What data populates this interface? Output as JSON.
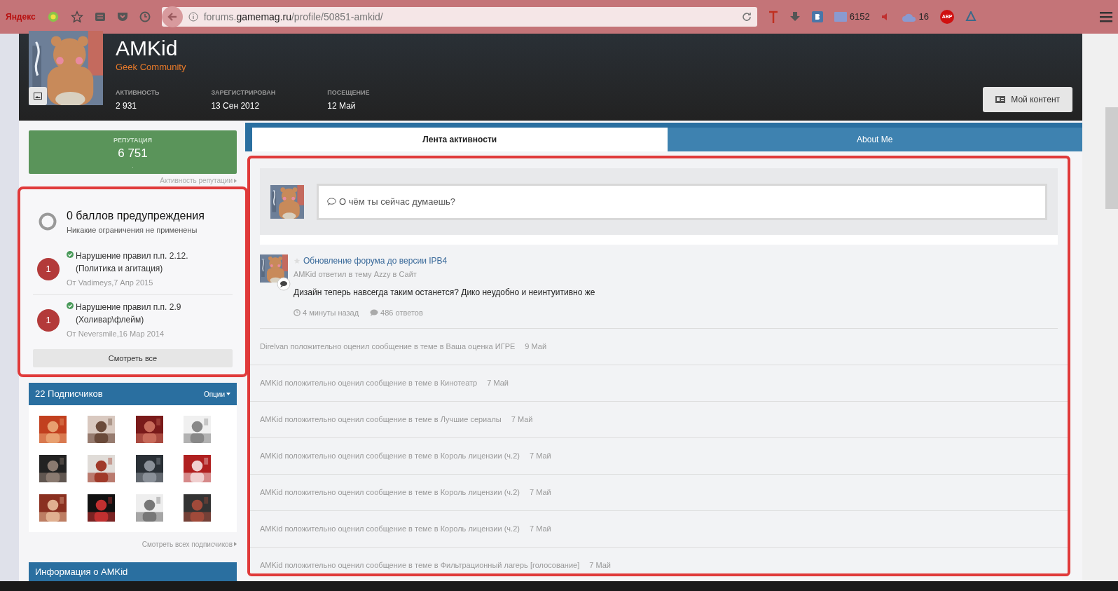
{
  "browser": {
    "brand": "Яндекс",
    "url_prefix": "forums.",
    "url_domain": "gamemag.ru",
    "url_path": "/profile/50851-amkid/",
    "mail_count": "6152",
    "cloud_count": "16",
    "adblock_label": "ABP"
  },
  "profile": {
    "name": "AMKid",
    "group": "Geek Community",
    "stats": [
      {
        "label": "АКТИВНОСТЬ",
        "value": "2 931"
      },
      {
        "label": "ЗАРЕГИСТРИРОВАН",
        "value": "13 Сен 2012"
      },
      {
        "label": "ПОСЕЩЕНИЕ",
        "value": "12 Май"
      }
    ],
    "content_button": "Мой контент"
  },
  "reputation": {
    "label": "РЕПУТАЦИЯ",
    "value": "6 751",
    "dot": ".",
    "link": "Активность репутации"
  },
  "warnings": {
    "title": "0 баллов предупреждения",
    "subtitle": "Никакие ограничения не применены",
    "items": [
      {
        "points": "1",
        "title": "Нарушение правил п.п. 2.12. (Политика и агитация)",
        "meta": "От Vadimeys,7 Апр 2015"
      },
      {
        "points": "1",
        "title": "Нарушение правил п.п. 2.9 (Холивар\\флейм)",
        "meta": "От Neversmile,16 Мар 2014"
      }
    ],
    "view_all": "Смотреть все"
  },
  "followers": {
    "title": "22 Подписчиков",
    "options": "Опции",
    "view_all": "Смотреть всех подписчиков"
  },
  "info_header": "Информация о AMKid",
  "tabs": [
    {
      "label": "Лента активности",
      "selected": true
    },
    {
      "label": "About Me",
      "selected": false
    }
  ],
  "composer": {
    "placeholder": "О чём ты сейчас думаешь?"
  },
  "post": {
    "title": "Обновление форума до версии IPB4",
    "meta": "AMKid ответил в тему Azzy в Сайт",
    "text": "Дизайн теперь навсегда таким останется? Дико неудобно и неинтуитивно же",
    "time": "4 минуты назад",
    "replies": "486 ответов"
  },
  "activity": [
    {
      "text": "Direlvan положительно оценил сообщение в теме в Ваша оценка ИГРЕ",
      "date": "9 Май"
    },
    {
      "text": "AMKid положительно оценил сообщение в теме в Кинотеатр",
      "date": "7 Май"
    },
    {
      "text": "AMKid положительно оценил сообщение в теме в Лучшие сериалы",
      "date": "7 Май"
    },
    {
      "text": "AMKid положительно оценил сообщение в теме в Король лицензии (ч.2)",
      "date": "7 Май"
    },
    {
      "text": "AMKid положительно оценил сообщение в теме в Король лицензии (ч.2)",
      "date": "7 Май"
    },
    {
      "text": "AMKid положительно оценил сообщение в теме в Король лицензии (ч.2)",
      "date": "7 Май"
    },
    {
      "text": "AMKid положительно оценил сообщение в теме в Фильтрационный лагерь [голосование]",
      "date": "7 Май"
    }
  ]
}
